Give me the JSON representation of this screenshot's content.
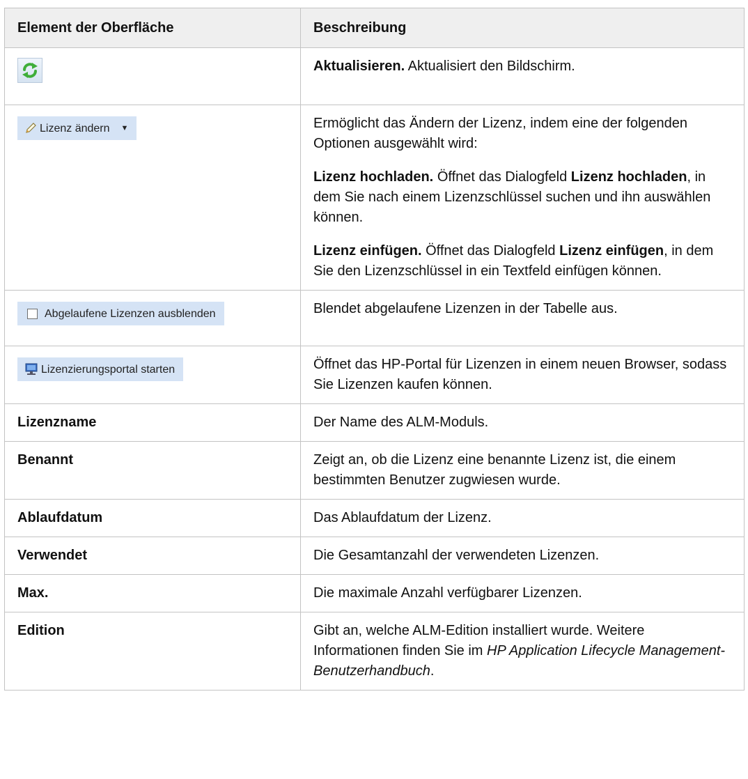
{
  "header": {
    "col1": "Element der Oberfläche",
    "col2": "Beschreibung"
  },
  "rows": {
    "refresh": {
      "icon": "refresh-icon",
      "title": "Aktualisieren.",
      "text": "Aktualisiert den Bildschirm."
    },
    "change_license": {
      "button_label": "Lizenz ändern",
      "icon": "pencil-icon",
      "intro": "Ermöglicht das Ändern der Lizenz, indem eine der folgenden Optionen ausgewählt wird:",
      "upload_title": "Lizenz hochladen.",
      "upload_pre": "Öffnet das Dialogfeld",
      "upload_dialog": "Lizenz hochladen",
      "upload_post": ", in dem Sie nach einem Lizenzschlüssel suchen und ihn auswählen können.",
      "paste_title": "Lizenz einfügen.",
      "paste_pre": "Öffnet das Dialogfeld",
      "paste_dialog": "Lizenz einfügen",
      "paste_post": ", in dem Sie den Lizenzschlüssel in ein Textfeld einfügen können."
    },
    "hide_expired": {
      "checkbox_label": "Abgelaufene Lizenzen ausblenden",
      "checked": false,
      "text": "Blendet abgelaufene Lizenzen in der Tabelle aus."
    },
    "portal": {
      "button_label": "Lizenzierungsportal starten",
      "icon": "monitor-icon",
      "text": "Öffnet das HP-Portal für Lizenzen in einem neuen Browser, sodass Sie Lizenzen kaufen können."
    },
    "license_name": {
      "name": "Lizenzname",
      "text": "Der Name des ALM-Moduls."
    },
    "named": {
      "name": "Benannt",
      "text": "Zeigt an, ob die Lizenz eine benannte Lizenz ist, die einem bestimmten Benutzer zugwiesen wurde."
    },
    "expiry": {
      "name": "Ablaufdatum",
      "text": "Das Ablaufdatum der Lizenz."
    },
    "used": {
      "name": "Verwendet",
      "text": "Die Gesamtanzahl der verwendeten Lizenzen."
    },
    "max": {
      "name": "Max.",
      "text": "Die maximale Anzahl verfügbarer Lizenzen."
    },
    "edition": {
      "name": "Edition",
      "text_pre": "Gibt an, welche ALM-Edition installiert wurde. Weitere Informationen finden Sie im ",
      "book": "HP Application Lifecycle Management-Benutzerhandbuch",
      "text_post": "."
    }
  },
  "colors": {
    "header_bg": "#efefef",
    "border": "#c3c3c3",
    "button_bg": "#d5e3f5",
    "refresh_green": "#3fae3a"
  }
}
